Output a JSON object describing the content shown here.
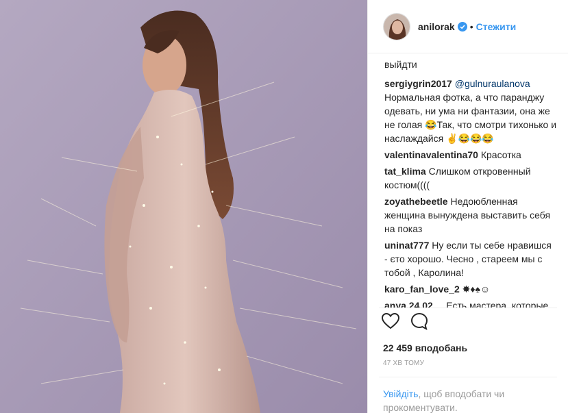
{
  "post": {
    "author": {
      "username": "anilorak",
      "verified_icon": "verified-badge-icon",
      "separator": "•",
      "follow_label": "Стежити",
      "accent": "#3897f0"
    },
    "comments": [
      {
        "user": "",
        "text": "выйдти"
      },
      {
        "user": "sergiygrin2017",
        "mention": "@gulnuraulanova",
        "text": "Нормальная фотка, а что паранджу одевать, ни ума ни фантазии, она же не голая 😂Так, что смотри тихонько и наслаждайся ✌😂😂😂"
      },
      {
        "user": "valentinavalentina70",
        "text": "Красотка"
      },
      {
        "user": "tat_klima",
        "text": "Слишком откровенный костюм(((("
      },
      {
        "user": "zoyathebeetle",
        "text": "Недоюбленная женщина вынуждена выставить себя на показ"
      },
      {
        "user": "uninat777",
        "text": "Ну если ты себе нравишся - єто хорошо. Чесно , стареем мы с тобой , Каролина!"
      },
      {
        "user": "karo_fan_love_2",
        "text": "✸♦♠☺"
      },
      {
        "user": "anya.24.02__",
        "text": "Есть мастера, которые передают свои чувства через кисти и краску, игру на инструменте🎸 А вы"
      }
    ],
    "actions": {
      "like_icon": "heart-icon",
      "comment_icon": "comment-bubble-icon"
    },
    "likes_text": "22 459 вподобань",
    "time_text": "47 хв тому",
    "login": {
      "link_text": "Увійдіть",
      "rest_text": ", щоб вподобати чи прокоментувати."
    }
  }
}
